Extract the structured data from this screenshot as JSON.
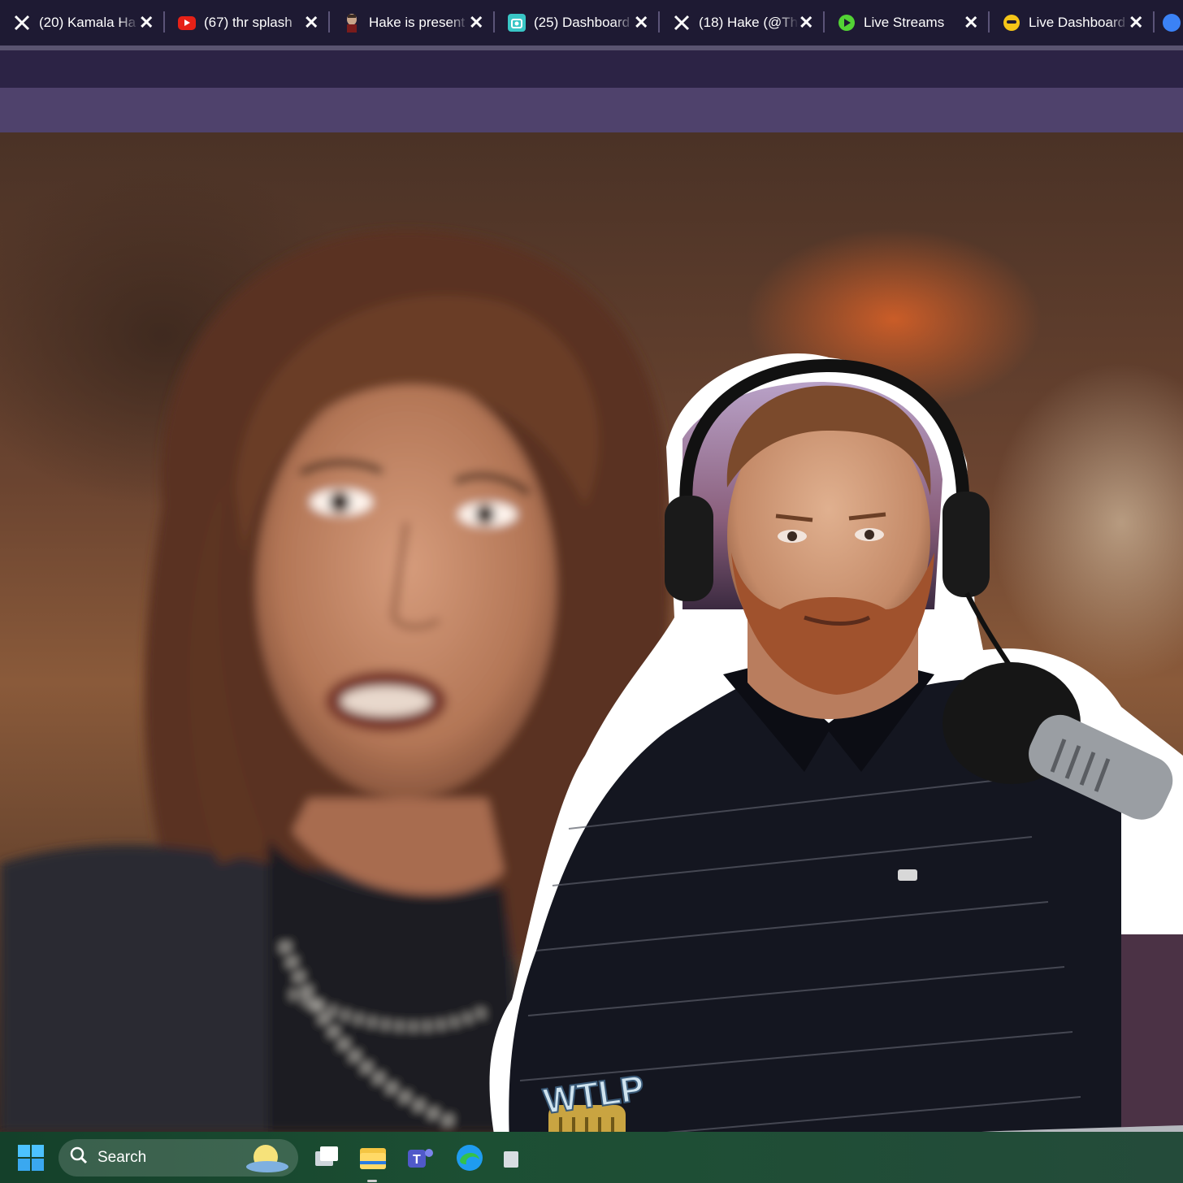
{
  "browser": {
    "tabs": [
      {
        "title": "(20) Kamala Ha",
        "icon": "x-logo-icon"
      },
      {
        "title": "(67) thr splash",
        "icon": "youtube-icon"
      },
      {
        "title": "Hake is present",
        "icon": "hake-icon"
      },
      {
        "title": "(25) Dashboard",
        "icon": "dashboard-icon"
      },
      {
        "title": "(18) Hake (@Th",
        "icon": "x-logo-icon"
      },
      {
        "title": "Live Streams",
        "icon": "play-icon"
      },
      {
        "title": "Live Dashboard",
        "icon": "smiley-icon"
      }
    ],
    "close_glyph": "✕"
  },
  "taskbar": {
    "search_label": "Search"
  },
  "overlay": {
    "logo_text": "WTLP"
  },
  "colors": {
    "tabstrip": "#1e1a33",
    "bar_dark": "#2c2345",
    "bar_light": "#4f426c",
    "taskbar": "#1c4f33"
  }
}
